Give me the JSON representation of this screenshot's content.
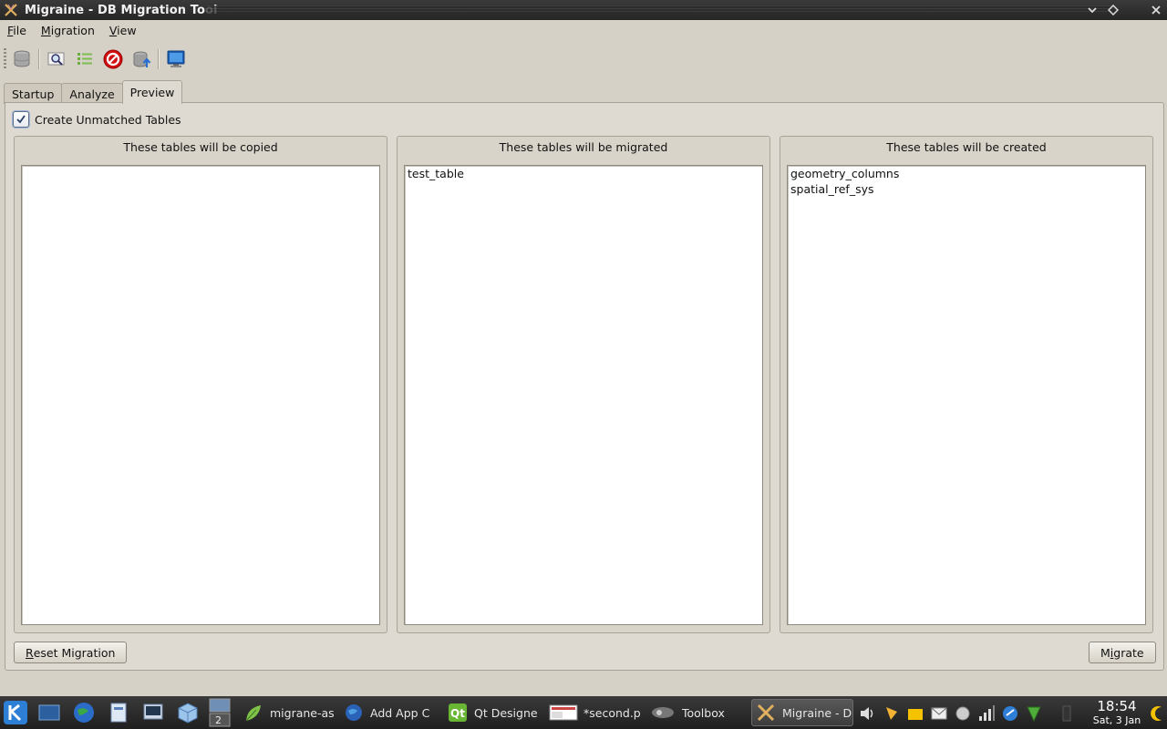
{
  "window": {
    "title": "Migraine - DB Migration Tool"
  },
  "menu": {
    "file": {
      "hot": "F",
      "rest": "ile"
    },
    "migration": {
      "hot": "M",
      "rest": "igration"
    },
    "view": {
      "hot": "V",
      "rest": "iew"
    }
  },
  "toolbar": {
    "icons": [
      "database-icon",
      "magnifier-icon",
      "list-icon",
      "stop-icon",
      "database-upload-icon",
      "monitor-icon"
    ]
  },
  "tabs": [
    {
      "label": "Startup",
      "active": false
    },
    {
      "label": "Analyze",
      "active": false
    },
    {
      "label": "Preview",
      "active": true
    }
  ],
  "options": {
    "create_unmatched_label": "Create Unmatched Tables",
    "create_unmatched_checked": true
  },
  "panels": {
    "copied": {
      "title": "These tables will be copied",
      "items": []
    },
    "migrated": {
      "title": "These tables will be migrated",
      "items": [
        "test_table"
      ]
    },
    "created": {
      "title": "These tables will be created",
      "items": [
        "geometry_columns",
        "spatial_ref_sys"
      ]
    }
  },
  "buttons": {
    "reset": {
      "hot": "R",
      "rest": "eset Migration"
    },
    "migrate": {
      "pre": "M",
      "hot": "i",
      "rest": "grate"
    }
  },
  "taskbar": {
    "tasks": [
      {
        "label": "migrane-as",
        "icon": "leaf-icon",
        "active": false
      },
      {
        "label": "Add   App C",
        "icon": "globe-icon",
        "active": false
      },
      {
        "label": "Qt Designe",
        "icon": "qt-icon",
        "active": false
      },
      {
        "label": "*second.p",
        "icon": "document-icon",
        "active": false
      },
      {
        "label": "Toolbox",
        "icon": "toolbox-icon",
        "active": false
      },
      {
        "label": "Migraine - D",
        "icon": "migraine-icon",
        "active": true
      }
    ],
    "pager": "2",
    "clock": {
      "time": "18:54",
      "date": "Sat, 3 Jan"
    }
  },
  "colors": {
    "window_bg": "#d6d1c6",
    "titlebar": "#2f2f2f",
    "taskbar": "#2a2a2a",
    "stop_red": "#d01010"
  }
}
